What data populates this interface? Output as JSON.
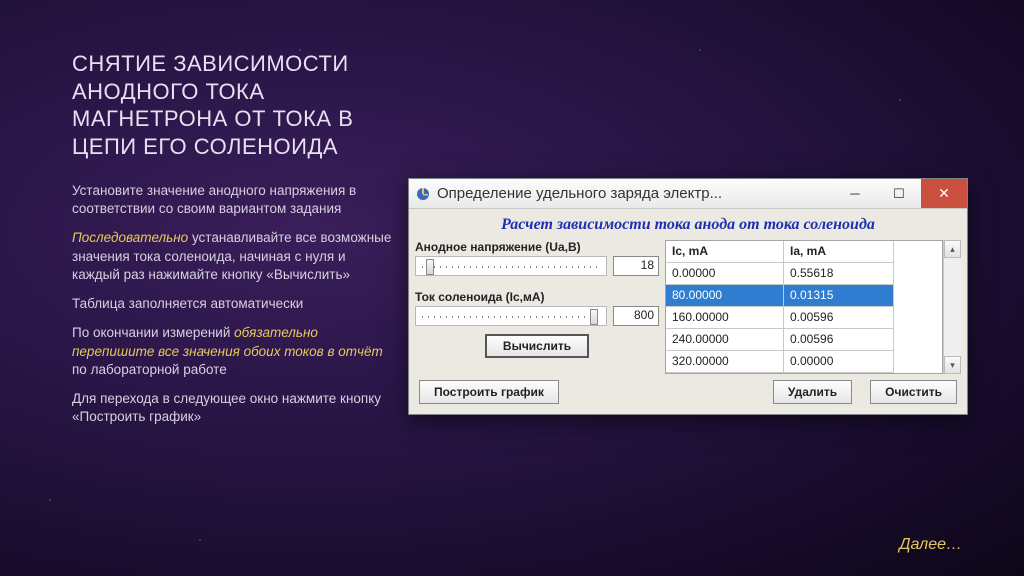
{
  "slide": {
    "title": "СНЯТИЕ ЗАВИСИМОСТИ АНОДНОГО ТОКА МАГНЕТРОНА ОТ ТОКА В ЦЕПИ ЕГО СОЛЕНОИДА",
    "p1": "Установите значение анодного напряжения в соответствии со своим вариантом задания",
    "p2a": "Последовательно",
    "p2b": " устанавливайте все возможные значения тока соленоида, начиная с нуля и каждый раз нажимайте кнопку «Вычислить»",
    "p3": "Таблица заполняется автоматически",
    "p4a": "По окончании измерений ",
    "p4b": "обязательно перепишите все значения обоих токов в отчёт",
    "p4c": " по лабораторной работе",
    "p5": "Для перехода в следующее окно нажмите кнопку «Построить график»",
    "next": "Далее…"
  },
  "app": {
    "title": "Определение удельного заряда электр...",
    "caption": "Расчет зависимости тока анода от тока соленоида",
    "voltage_label": "Анодное напряжение (Ua,В)",
    "voltage_value": "18",
    "solenoid_label": "Ток соленоида (Ic,мА)",
    "solenoid_value": "800",
    "calc_btn": "Вычислить",
    "plot_btn": "Построить график",
    "delete_btn": "Удалить",
    "clear_btn": "Очистить",
    "col1": "Ic, mA",
    "col2": "Ia, mA",
    "rows": [
      {
        "ic": "0.00000",
        "ia": "0.55618",
        "selected": false
      },
      {
        "ic": "80.00000",
        "ia": "0.01315",
        "selected": true
      },
      {
        "ic": "160.00000",
        "ia": "0.00596",
        "selected": false
      },
      {
        "ic": "240.00000",
        "ia": "0.00596",
        "selected": false
      },
      {
        "ic": "320.00000",
        "ia": "0.00000",
        "selected": false
      }
    ]
  },
  "chart_data": {
    "type": "table",
    "title": "Расчет зависимости тока анода от тока соленоида",
    "parameters": {
      "Ua_V": 18,
      "Ic_mA_setpoint": 800
    },
    "columns": [
      "Ic, mA",
      "Ia, mA"
    ],
    "series": [
      {
        "name": "Ic, mA",
        "values": [
          0.0,
          80.0,
          160.0,
          240.0,
          320.0
        ]
      },
      {
        "name": "Ia, mA",
        "values": [
          0.55618,
          0.01315,
          0.00596,
          0.00596,
          0.0
        ]
      }
    ],
    "xlabel": "Ic, mA",
    "ylabel": "Ia, mA"
  }
}
